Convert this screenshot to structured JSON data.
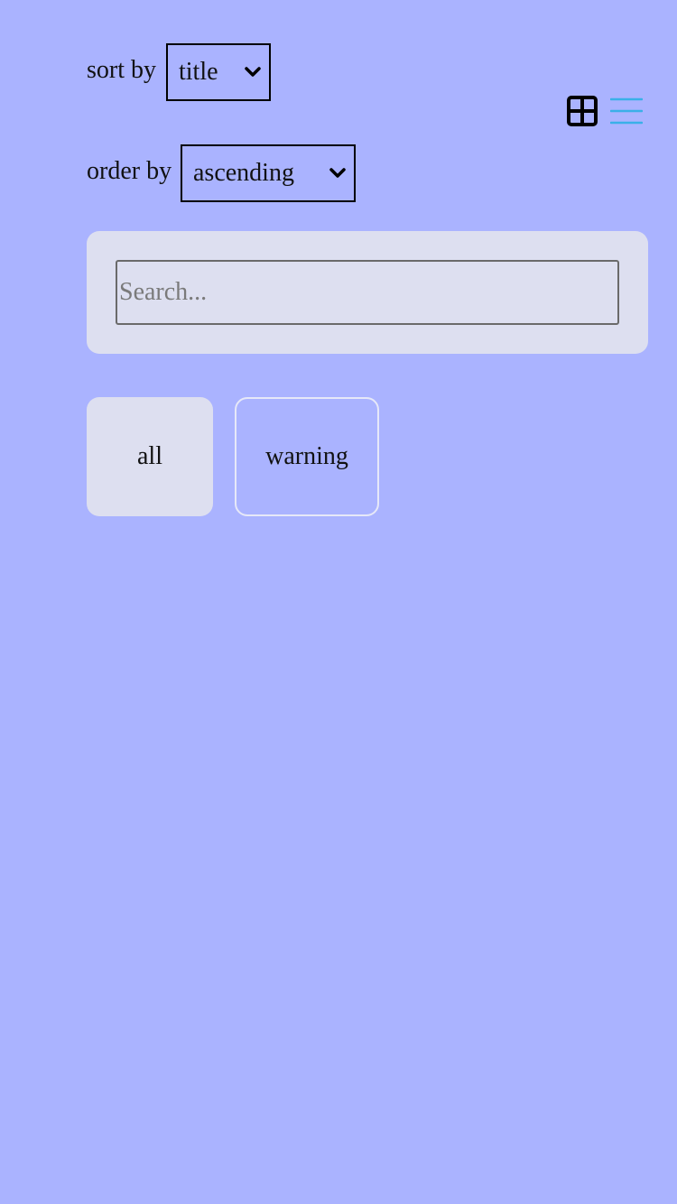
{
  "controls": {
    "sort_label": "sort by",
    "sort_value": "title",
    "order_label": "order by",
    "order_value": "ascending"
  },
  "view_toggle": {
    "grid_icon": "grid-icon",
    "list_icon": "list-icon",
    "list_color": "#3ab0e8"
  },
  "search": {
    "placeholder": "Search...",
    "value": ""
  },
  "filters": [
    {
      "label": "all",
      "active": true
    },
    {
      "label": "warning",
      "active": false
    }
  ],
  "colors": {
    "background": "#aab3ff",
    "panel": "#dddff0",
    "accent": "#3ab0e8"
  }
}
